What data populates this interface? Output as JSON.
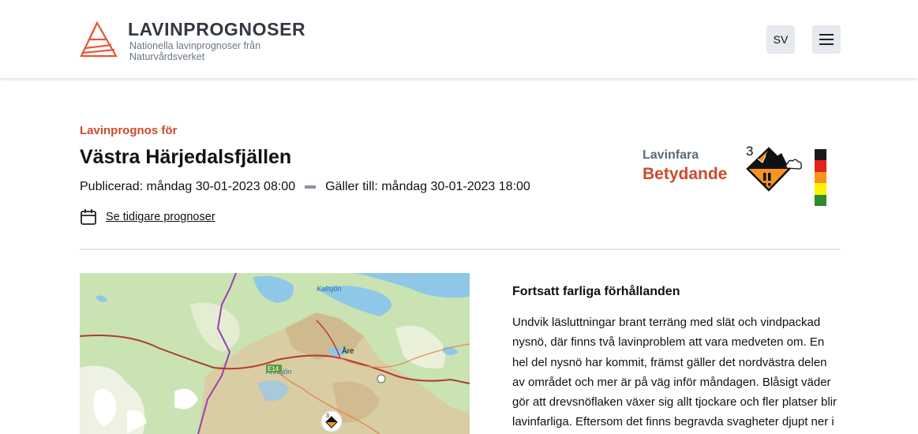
{
  "header": {
    "logo_title": "LAVINPROGNOSER",
    "logo_subtitle": "Nationella lavinprognoser från Naturvårdsverket",
    "language_label": "SV",
    "menu_icon": "hamburger-icon"
  },
  "forecast": {
    "eyebrow": "Lavinprognos för",
    "region": "Västra Härjedalsfjällen",
    "published": "Publicerad: måndag 30-01-2023 08:00",
    "valid_until": "Gäller till: måndag 30-01-2023 18:00",
    "earlier_link": "Se tidigare prognoser",
    "calendar_icon": "calendar-icon"
  },
  "danger": {
    "label": "Lavinfara",
    "level_name": "Betydande",
    "level_number": "3",
    "color": "#cf4a2c",
    "icon_fill": "#f7941d",
    "scale_colors": [
      "#1a1a1a",
      "#e2231a",
      "#f7941d",
      "#fff200",
      "#2e8b2e"
    ]
  },
  "map": {
    "labels": {
      "kallsjon": "Kallsjön",
      "are": "Åre",
      "annsjon": "Ånnsjön",
      "road": "E14",
      "marker_level": "3"
    }
  },
  "summary": {
    "title": "Fortsatt farliga förhållanden",
    "body": "Undvik läsluttningar brant terräng med slät och vindpackad nysnö, där finns två lavinproblem att vara medveten om. En hel del nysnö har kommit, främst gäller det nordvästra delen av området och mer är på väg inför måndagen. Blåsigt väder gör att drevsnöflaken växer sig allt tjockare och fler platser blir lavinfarliga. Eftersom det finns begravda svagheter djupt ner i"
  }
}
